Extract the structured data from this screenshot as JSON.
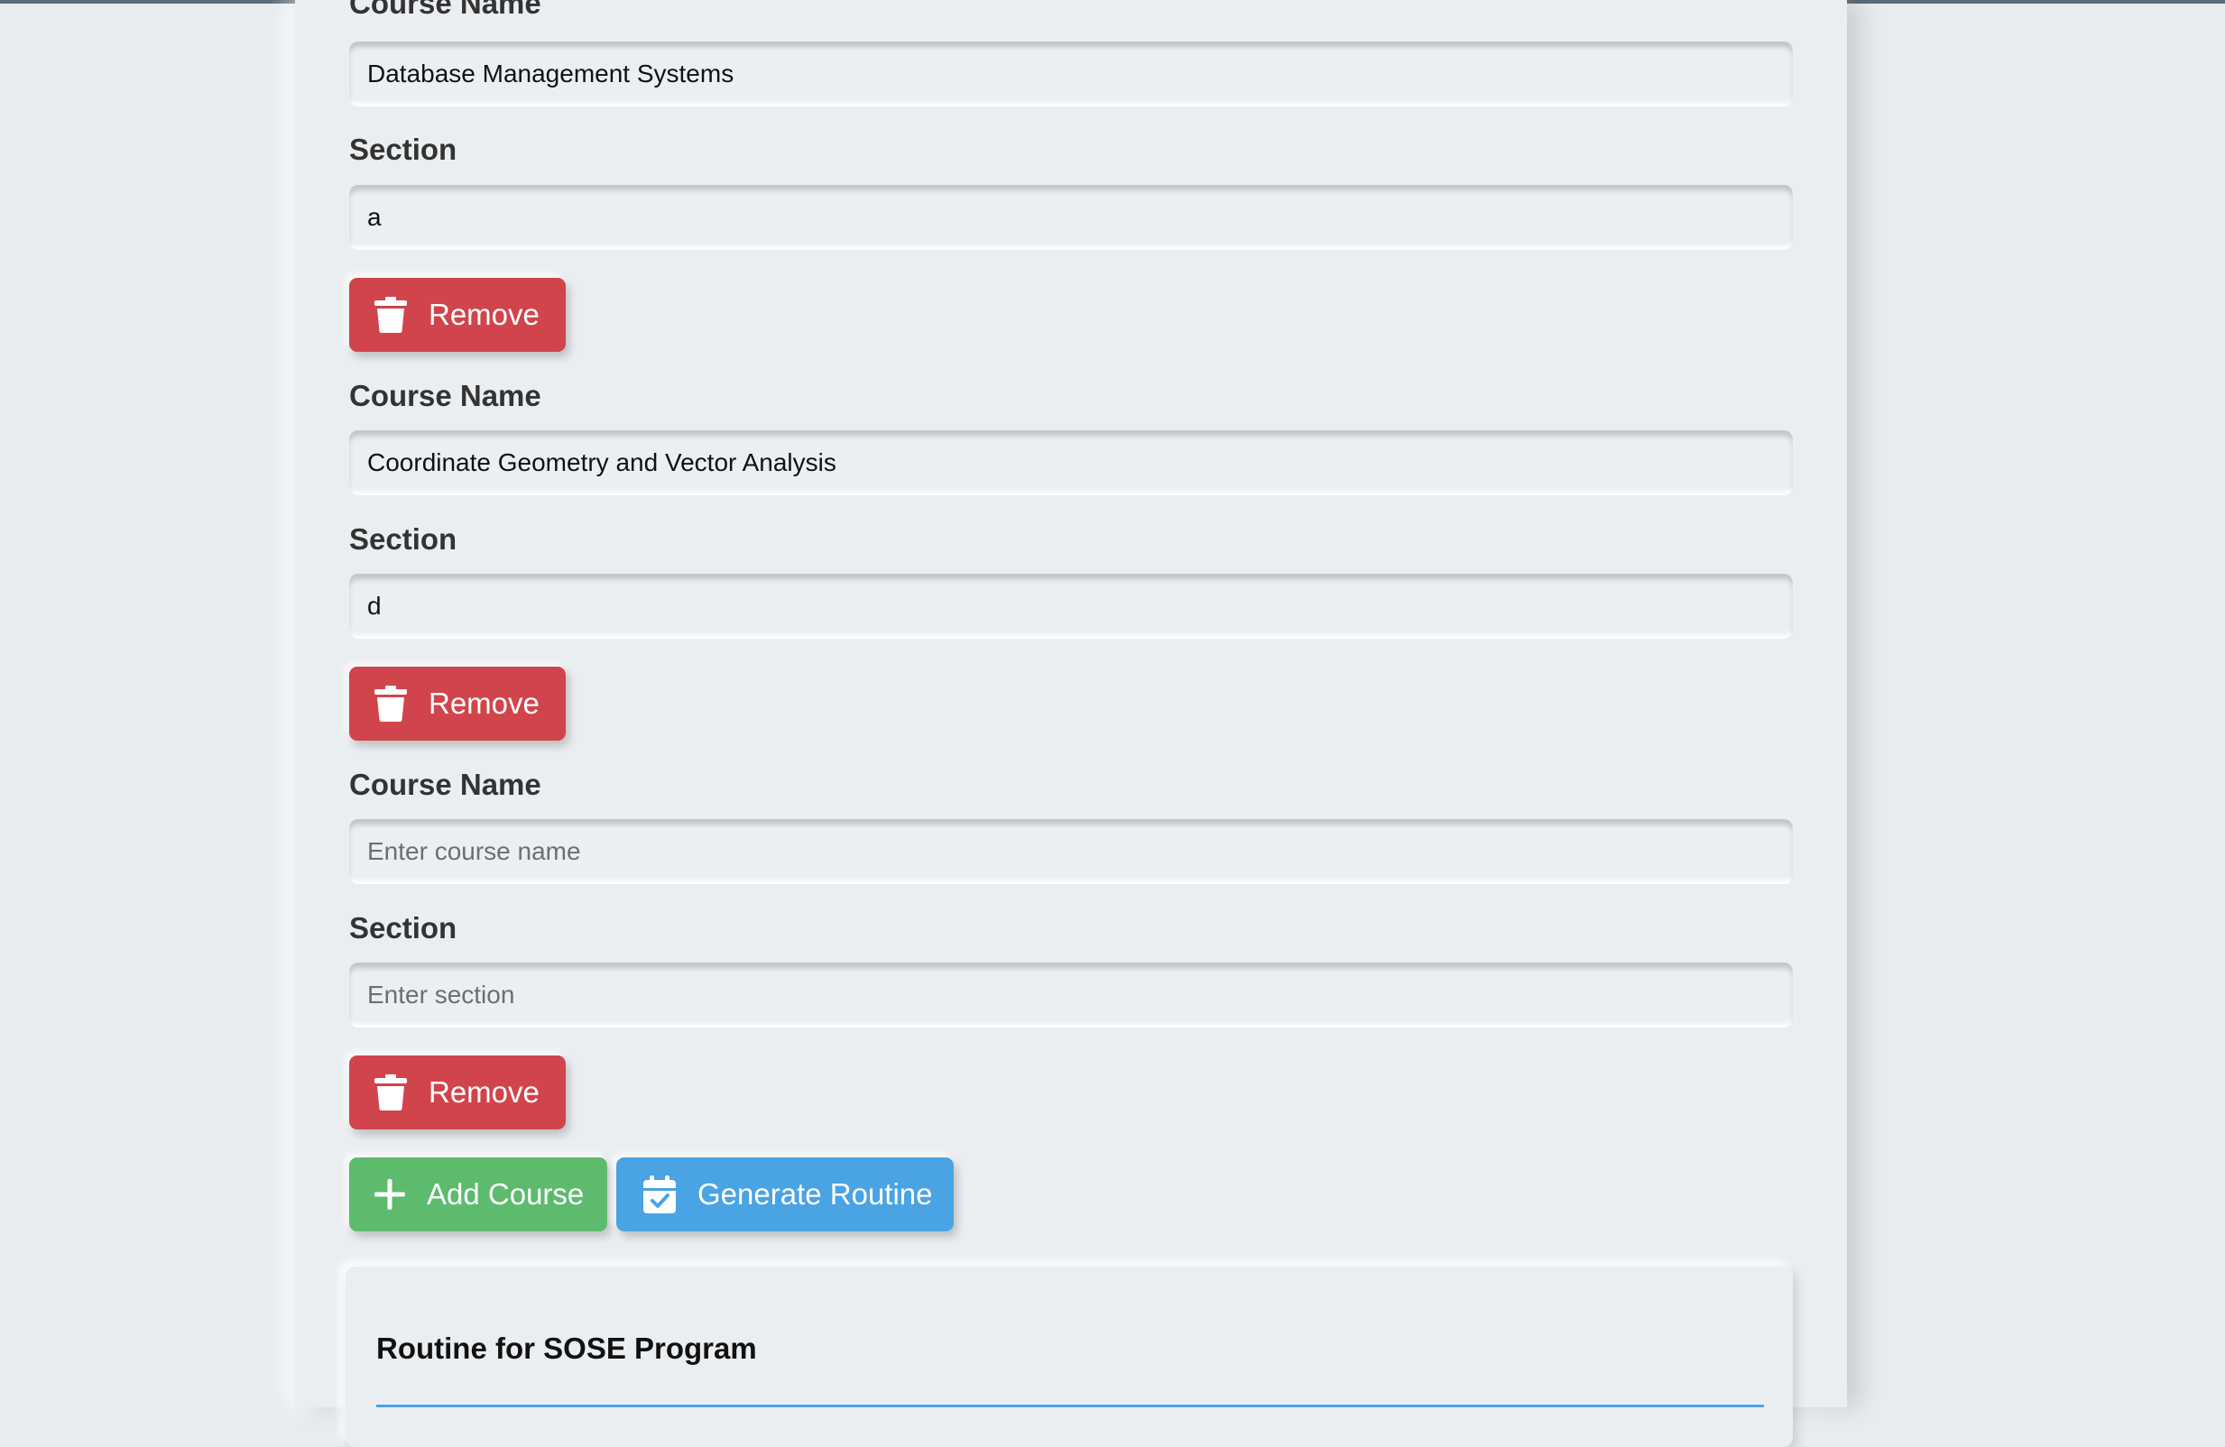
{
  "labels": {
    "course_name": "Course Name",
    "section": "Section"
  },
  "courses": [
    {
      "course_name": "Database Management Systems",
      "section": "a"
    },
    {
      "course_name": "Coordinate Geometry and Vector Analysis",
      "section": "d"
    },
    {
      "course_name": "",
      "section": ""
    }
  ],
  "placeholders": {
    "course_name": "Enter course name",
    "section": "Enter section"
  },
  "buttons": {
    "remove": "Remove",
    "add_course": "Add Course",
    "generate_routine": "Generate Routine"
  },
  "icons": {
    "remove": "trash-icon",
    "add_course": "plus-icon",
    "generate_routine": "calendar-check-icon"
  },
  "routine": {
    "title": "Routine for SOSE Program"
  },
  "colors": {
    "remove": "#d1444b",
    "add_course": "#5dbb6e",
    "generate_routine": "#4aa3e3",
    "background": "#e8ecef"
  }
}
